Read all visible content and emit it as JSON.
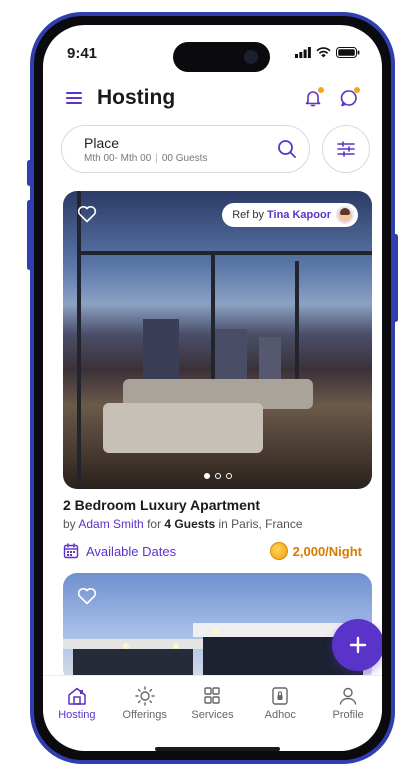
{
  "status_bar": {
    "time": "9:41"
  },
  "header": {
    "title": "Hosting"
  },
  "search": {
    "place": "Place",
    "dates": "Mth 00- Mth 00",
    "guests": "00 Guests"
  },
  "listing": {
    "ref_by": "Ref by",
    "ref_name": "Tina Kapoor",
    "title": "2 Bedroom Luxury Apartment",
    "by": "by",
    "host": "Adam Smith",
    "for": "for",
    "guests": "4 Guests",
    "in": "in",
    "location": "Paris, France",
    "available_dates": "Available Dates",
    "price": "2,000/Night",
    "carousel_pages": 3,
    "carousel_active": 1
  },
  "bottom_nav": [
    {
      "label": "Hosting",
      "icon": "home-icon",
      "active": true
    },
    {
      "label": "Offerings",
      "icon": "sun-icon",
      "active": false
    },
    {
      "label": "Services",
      "icon": "grid-icon",
      "active": false
    },
    {
      "label": "Adhoc",
      "icon": "lock-box-icon",
      "active": false
    },
    {
      "label": "Profile",
      "icon": "user-icon",
      "active": false
    }
  ],
  "colors": {
    "accent": "#5a33c9",
    "price": "#d97a00",
    "notification_dot": "#f5a623",
    "frame": "#2f3fb0"
  }
}
